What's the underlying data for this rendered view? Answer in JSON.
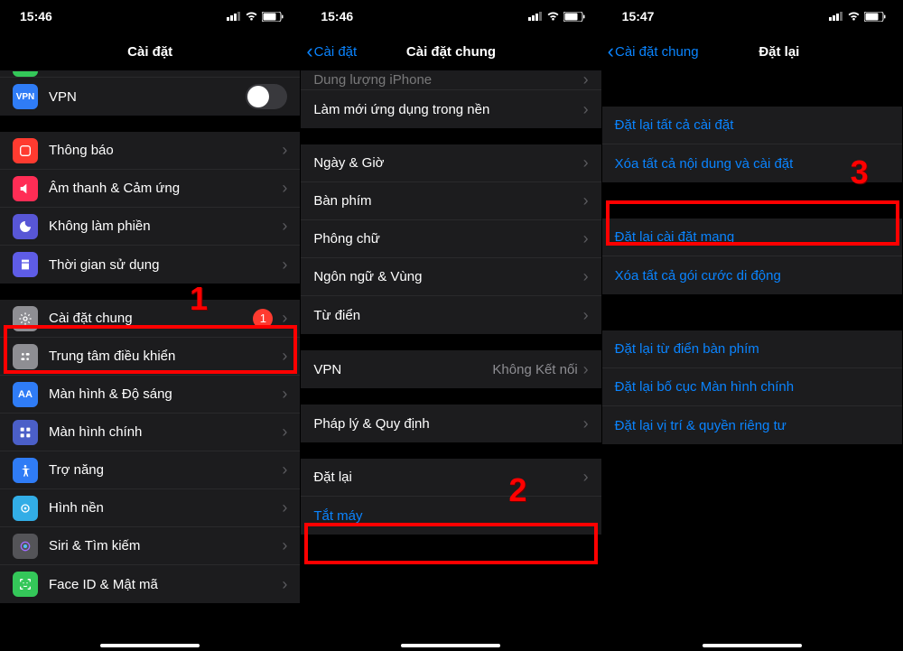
{
  "s1": {
    "time": "15:46",
    "title": "Cài đặt",
    "vpn": "VPN",
    "rows1": [
      "Thông báo",
      "Âm thanh & Cảm ứng",
      "Không làm phiền",
      "Thời gian sử dụng"
    ],
    "general": "Cài đặt chung",
    "badge": "1",
    "rows2": [
      "Trung tâm điều khiển",
      "Màn hình & Độ sáng",
      "Màn hình chính",
      "Trợ năng",
      "Hình nền",
      "Siri & Tìm kiếm",
      "Face ID & Mật mã"
    ],
    "annot1": "1"
  },
  "s2": {
    "time": "15:46",
    "back": "Cài đặt",
    "title": "Cài đặt chung",
    "row_cut": "Dung lượng iPhone",
    "row_bg": "Làm mới ứng dụng trong nền",
    "rows1": [
      "Ngày & Giờ",
      "Bàn phím",
      "Phông chữ",
      "Ngôn ngữ & Vùng",
      "Từ điển"
    ],
    "vpn": "VPN",
    "vpn_detail": "Không Kết nối",
    "legal": "Pháp lý & Quy định",
    "reset": "Đặt lại",
    "shutdown": "Tắt máy",
    "annot2": "2"
  },
  "s3": {
    "time": "15:47",
    "back": "Cài đặt chung",
    "title": "Đặt lại",
    "rows1": [
      "Đặt lại tất cả cài đặt",
      "Xóa tất cả nội dung và cài đặt"
    ],
    "rows2": [
      "Đặt lại cài đặt mạng",
      "Xóa tất cả gói cước di động"
    ],
    "rows3": [
      "Đặt lại từ điển bàn phím",
      "Đặt lại bố cục Màn hình chính",
      "Đặt lại vị trí & quyền riêng tư"
    ],
    "annot3": "3"
  }
}
